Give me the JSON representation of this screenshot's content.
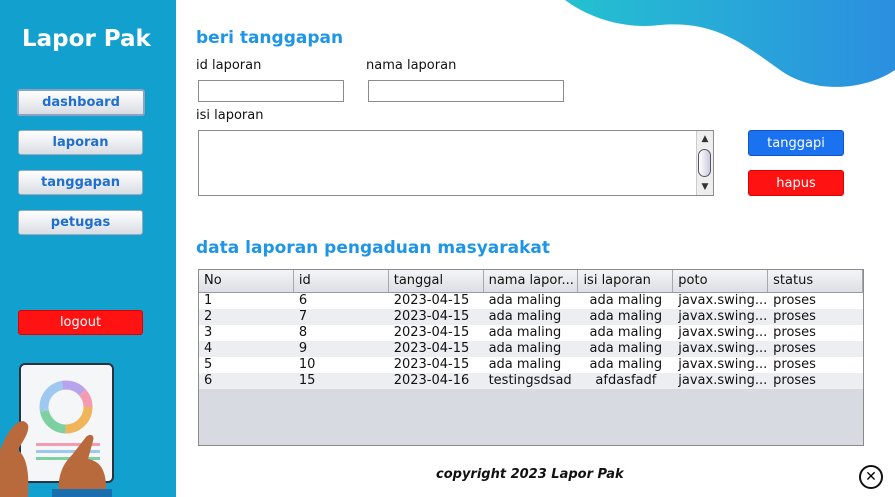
{
  "sidebar": {
    "app_title": "Lapor Pak",
    "nav": [
      {
        "label": "dashboard"
      },
      {
        "label": "laporan"
      },
      {
        "label": "tanggapan"
      },
      {
        "label": "petugas"
      }
    ],
    "logout_label": "logout"
  },
  "form": {
    "title": "beri tanggapan",
    "id_label": "id laporan",
    "id_value": "",
    "name_label": "nama laporan",
    "name_value": "",
    "content_label": "isi laporan",
    "content_value": "",
    "respond_label": "tanggapi",
    "delete_label": "hapus"
  },
  "table": {
    "title": "data laporan pengaduan masyarakat",
    "columns": [
      "No",
      "id",
      "tanggal",
      "nama lapor...",
      "isi laporan",
      "poto",
      "status"
    ],
    "rows": [
      [
        "1",
        "6",
        "2023-04-15",
        "ada maling",
        "ada maling",
        "javax.swing...",
        "proses"
      ],
      [
        "2",
        "7",
        "2023-04-15",
        "ada maling",
        "ada maling",
        "javax.swing...",
        "proses"
      ],
      [
        "3",
        "8",
        "2023-04-15",
        "ada maling",
        "ada maling",
        "javax.swing...",
        "proses"
      ],
      [
        "4",
        "9",
        "2023-04-15",
        "ada maling",
        "ada maling",
        "javax.swing...",
        "proses"
      ],
      [
        "5",
        "10",
        "2023-04-15",
        "ada maling",
        "ada maling",
        "javax.swing...",
        "proses"
      ],
      [
        "6",
        "15",
        "2023-04-16",
        "testingsdsad",
        "afdasfadf",
        "javax.swing...",
        "proses"
      ]
    ]
  },
  "footer": {
    "copyright": "copyright 2023 Lapor Pak"
  },
  "icons": {
    "close": "close-circle-icon",
    "scroll_up": "scroll-up-icon",
    "scroll_down": "scroll-down-icon"
  },
  "colors": {
    "sidebar": "#12a0cf",
    "accent_title": "#1e95e6",
    "respond_button": "#1a72f0",
    "danger_button": "#ff1212",
    "wave": "#27c3d6"
  }
}
